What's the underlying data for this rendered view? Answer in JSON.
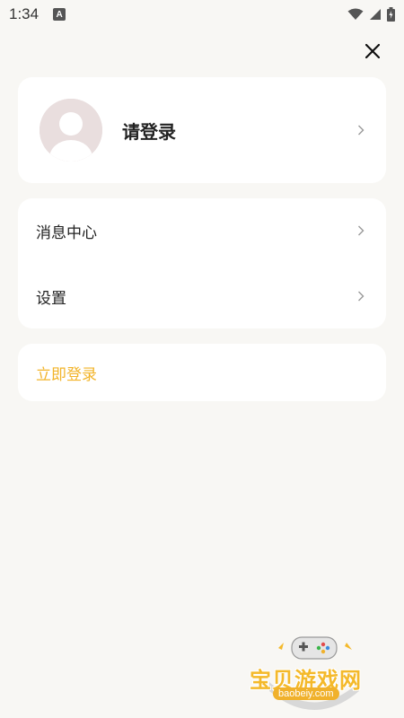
{
  "status_bar": {
    "time": "1:34",
    "notification_badge": "A"
  },
  "close_icon": "close-icon",
  "profile": {
    "name": "请登录",
    "avatar_icon": "user-avatar-placeholder",
    "chevron_icon": "chevron-right-icon"
  },
  "menu": {
    "items": [
      {
        "label": "消息中心",
        "icon": "chevron-right-icon"
      },
      {
        "label": "设置",
        "icon": "chevron-right-icon"
      }
    ]
  },
  "login": {
    "label": "立即登录",
    "color": "#f2b42a"
  },
  "watermark": {
    "title": "宝贝游戏网",
    "subtitle": "baobeiy.com"
  },
  "colors": {
    "background": "#f8f7f4",
    "card": "#ffffff",
    "accent": "#f2b42a"
  }
}
